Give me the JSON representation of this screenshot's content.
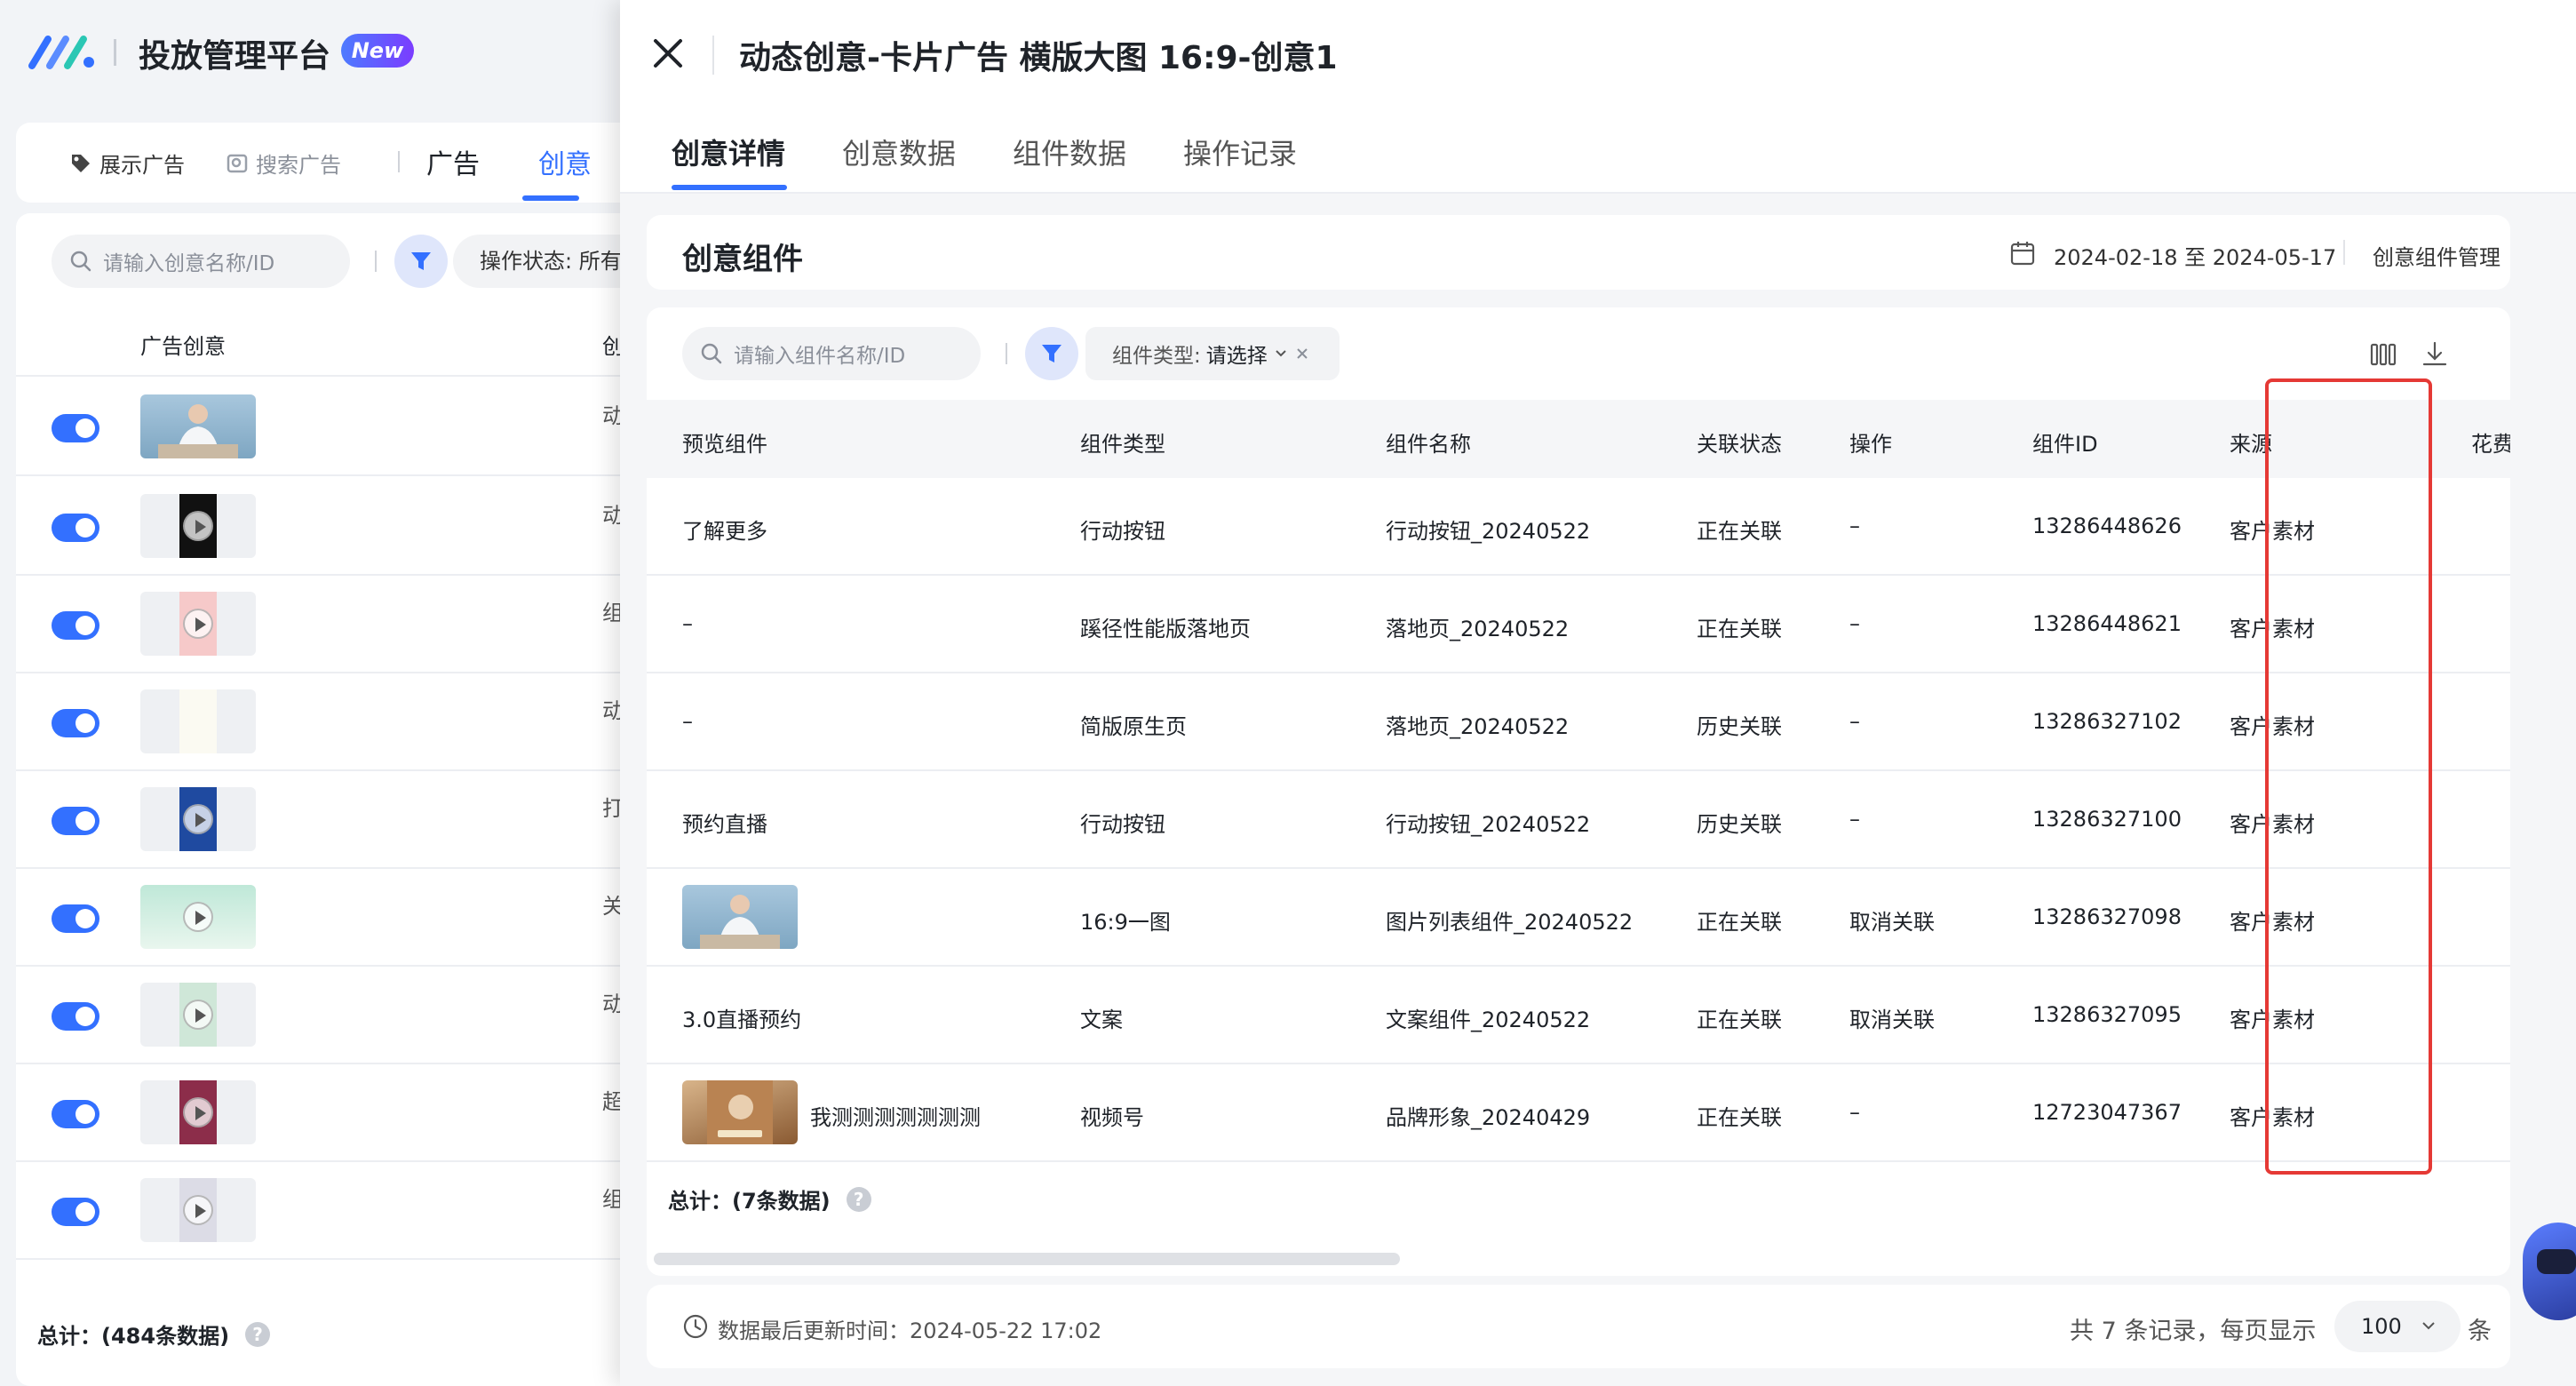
{
  "app": {
    "title": "投放管理平台",
    "badge": "New"
  },
  "nav": {
    "display_ads": "展示广告",
    "search_ads": "搜索广告",
    "tab_ads": "广告",
    "tab_creative": "创意"
  },
  "left": {
    "search_placeholder": "请输入创意名称/ID",
    "status_filter": "操作状态: 所有",
    "header_col1": "广告创意",
    "header_col2": "创",
    "rows": [
      {
        "enabled": true,
        "text": "动"
      },
      {
        "enabled": true,
        "text": "动"
      },
      {
        "enabled": true,
        "text": "组"
      },
      {
        "enabled": true,
        "text": "动"
      },
      {
        "enabled": true,
        "text": "打"
      },
      {
        "enabled": true,
        "text": "关"
      },
      {
        "enabled": true,
        "text": "动"
      },
      {
        "enabled": true,
        "text": "超"
      },
      {
        "enabled": true,
        "text": "组"
      }
    ],
    "total": "总计：(484条数据)"
  },
  "drawer": {
    "title": "动态创意-卡片广告 横版大图 16:9-创意1",
    "tabs": [
      "创意详情",
      "创意数据",
      "组件数据",
      "操作记录"
    ],
    "section_title": "创意组件",
    "date_range": "2024-02-18 至 2024-05-17",
    "component_mgmt": "创意组件管理",
    "search_placeholder": "请输入组件名称/ID",
    "type_filter_label": "组件类型:",
    "type_filter_value": "请选择",
    "columns": [
      "预览组件",
      "组件类型",
      "组件名称",
      "关联状态",
      "操作",
      "组件ID",
      "来源",
      "花费"
    ],
    "rows": [
      {
        "preview": "了解更多",
        "type": "行动按钮",
        "name": "行动按钮_20240522",
        "status": "正在关联",
        "action": "–",
        "id": "13286448626",
        "source": "客户素材"
      },
      {
        "preview": "–",
        "type": "蹊径性能版落地页",
        "name": "落地页_20240522",
        "status": "正在关联",
        "action": "–",
        "id": "13286448621",
        "source": "客户素材"
      },
      {
        "preview": "–",
        "type": "简版原生页",
        "name": "落地页_20240522",
        "status": "历史关联",
        "action": "–",
        "id": "13286327102",
        "source": "客户素材"
      },
      {
        "preview": "预约直播",
        "type": "行动按钮",
        "name": "行动按钮_20240522",
        "status": "历史关联",
        "action": "–",
        "id": "13286327100",
        "source": "客户素材"
      },
      {
        "preview": "",
        "type": "16:9一图",
        "name": "图片列表组件_20240522",
        "status": "正在关联",
        "action": "取消关联",
        "id": "13286327098",
        "source": "客户素材"
      },
      {
        "preview": "3.0直播预约",
        "type": "文案",
        "name": "文案组件_20240522",
        "status": "正在关联",
        "action": "取消关联",
        "id": "13286327095",
        "source": "客户素材"
      },
      {
        "preview": "我测测测测测测测",
        "type": "视频号",
        "name": "品牌形象_20240429",
        "status": "正在关联",
        "action": "–",
        "id": "12723047367",
        "source": "客户素材"
      }
    ],
    "total": "总计：(7条数据)",
    "updated": "数据最后更新时间：2024-05-22 17:02",
    "record_info": "共 7 条记录，每页显示",
    "page_size": "100",
    "unit": "条"
  },
  "colors": {
    "accent": "#3370ff",
    "highlight": "#e53935"
  }
}
